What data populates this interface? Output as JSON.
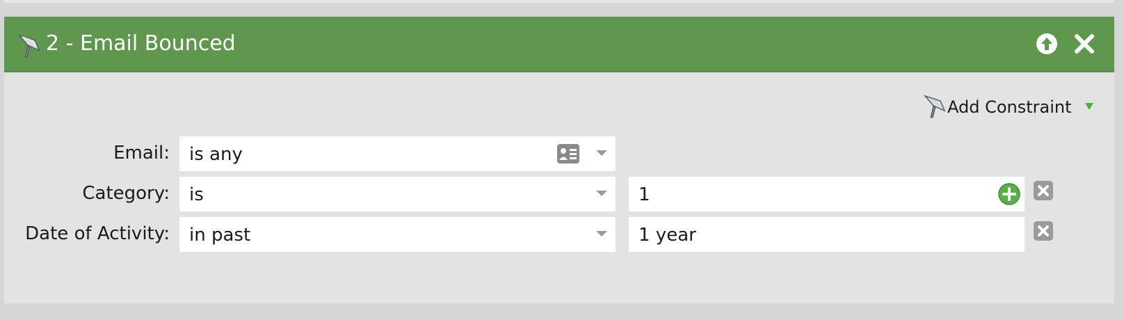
{
  "filter": {
    "title": "2 - Email Bounced",
    "move_up_icon": "arrow-up-circle-icon",
    "remove_icon": "close-x-icon"
  },
  "add_constraint": {
    "label": "Add Constraint",
    "icon": "filter-funnel-icon"
  },
  "rows": [
    {
      "label": "Email:",
      "operator": "is any",
      "value": ""
    },
    {
      "label": "Category:",
      "operator": "is",
      "value": "1"
    },
    {
      "label": "Date of Activity:",
      "operator": "in past",
      "value": "1 year"
    }
  ],
  "colors": {
    "header": "#5e974d",
    "panel": "#e3e3e3",
    "plus_green": "#5cb04a"
  }
}
